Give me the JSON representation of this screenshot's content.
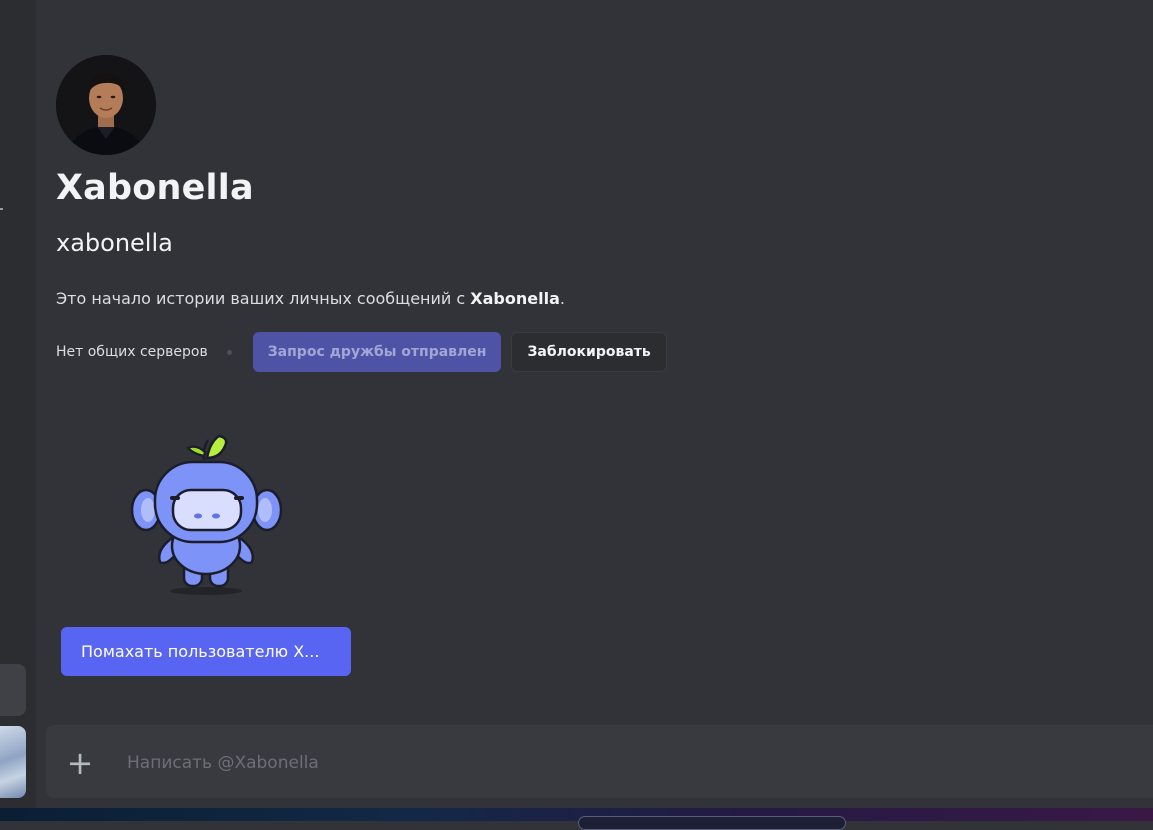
{
  "profile": {
    "display_name": "Xabonella",
    "username": "xabonella",
    "avatar_alt": "Xabonella"
  },
  "intro": {
    "prefix": "Это начало истории ваших личных сообщений с ",
    "name": "Xabonella",
    "suffix": "."
  },
  "actions": {
    "mutual_servers": "Нет общих серверов",
    "friend_request_sent": "Запрос дружбы отправлен",
    "block": "Заблокировать"
  },
  "wave": {
    "button_label": "Помахать пользователю X..."
  },
  "composer": {
    "placeholder": "Написать @Xabonella",
    "attach_icon": "plus-icon"
  },
  "colors": {
    "background": "#313338",
    "accent": "#5865f2",
    "friend_sent_button": "#4e53a6"
  }
}
